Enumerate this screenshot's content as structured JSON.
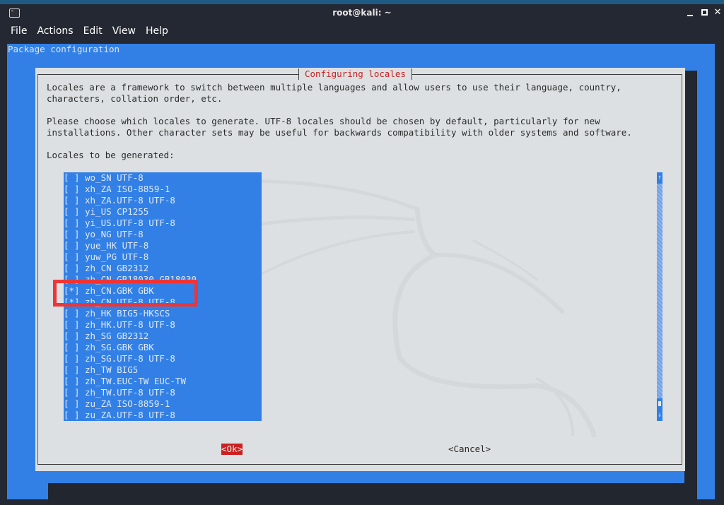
{
  "window": {
    "title": "root@kali: ~",
    "menu": [
      "File",
      "Actions",
      "Edit",
      "View",
      "Help"
    ]
  },
  "terminal": {
    "header": "Package configuration"
  },
  "dialog": {
    "title": "Configuring locales",
    "paragraphs": [
      "Locales are a framework to switch between multiple languages and allow users to use their language, country,\ncharacters, collation order, etc.",
      "Please choose which locales to generate. UTF-8 locales should be chosen by default, particularly for new\ninstallations. Other character sets may be useful for backwards compatibility with older systems and software."
    ],
    "list_label": "Locales to be generated:",
    "locales": [
      {
        "checkbox": "[ ]",
        "name": "wo_SN UTF-8",
        "checked": false
      },
      {
        "checkbox": "[ ]",
        "name": "xh_ZA ISO-8859-1",
        "checked": false
      },
      {
        "checkbox": "[ ]",
        "name": "xh_ZA.UTF-8 UTF-8",
        "checked": false
      },
      {
        "checkbox": "[ ]",
        "name": "yi_US CP1255",
        "checked": false
      },
      {
        "checkbox": "[ ]",
        "name": "yi_US.UTF-8 UTF-8",
        "checked": false
      },
      {
        "checkbox": "[ ]",
        "name": "yo_NG UTF-8",
        "checked": false
      },
      {
        "checkbox": "[ ]",
        "name": "yue_HK UTF-8",
        "checked": false
      },
      {
        "checkbox": "[ ]",
        "name": "yuw_PG UTF-8",
        "checked": false
      },
      {
        "checkbox": "[ ]",
        "name": "zh_CN GB2312",
        "checked": false
      },
      {
        "checkbox": "[ ]",
        "name": "zh_CN.GB18030 GB18030",
        "checked": false
      },
      {
        "checkbox": "[*]",
        "name": "zh_CN.GBK GBK",
        "checked": true
      },
      {
        "checkbox": "[*]",
        "name": "zh_CN.UTF-8 UTF-8",
        "checked": true
      },
      {
        "checkbox": "[ ]",
        "name": "zh_HK BIG5-HKSCS",
        "checked": false
      },
      {
        "checkbox": "[ ]",
        "name": "zh_HK.UTF-8 UTF-8",
        "checked": false
      },
      {
        "checkbox": "[ ]",
        "name": "zh_SG GB2312",
        "checked": false
      },
      {
        "checkbox": "[ ]",
        "name": "zh_SG.GBK GBK",
        "checked": false
      },
      {
        "checkbox": "[ ]",
        "name": "zh_SG.UTF-8 UTF-8",
        "checked": false
      },
      {
        "checkbox": "[ ]",
        "name": "zh_TW BIG5",
        "checked": false
      },
      {
        "checkbox": "[ ]",
        "name": "zh_TW.EUC-TW EUC-TW",
        "checked": false
      },
      {
        "checkbox": "[ ]",
        "name": "zh_TW.UTF-8 UTF-8",
        "checked": false
      },
      {
        "checkbox": "[ ]",
        "name": "zu_ZA ISO-8859-1",
        "checked": false
      },
      {
        "checkbox": "[ ]",
        "name": "zu_ZA.UTF-8 UTF-8",
        "checked": false
      }
    ],
    "scrollbar": {
      "up_glyph": "↑",
      "down_glyph": "↓",
      "position_fraction": 0.97
    },
    "ok_label": "<Ok>",
    "cancel_label": "<Cancel>"
  },
  "colors": {
    "terminal_bg": "#3280e6",
    "dialog_bg": "#dde0e2",
    "title_red": "#cc2020",
    "highlight_box": "#f03434"
  }
}
